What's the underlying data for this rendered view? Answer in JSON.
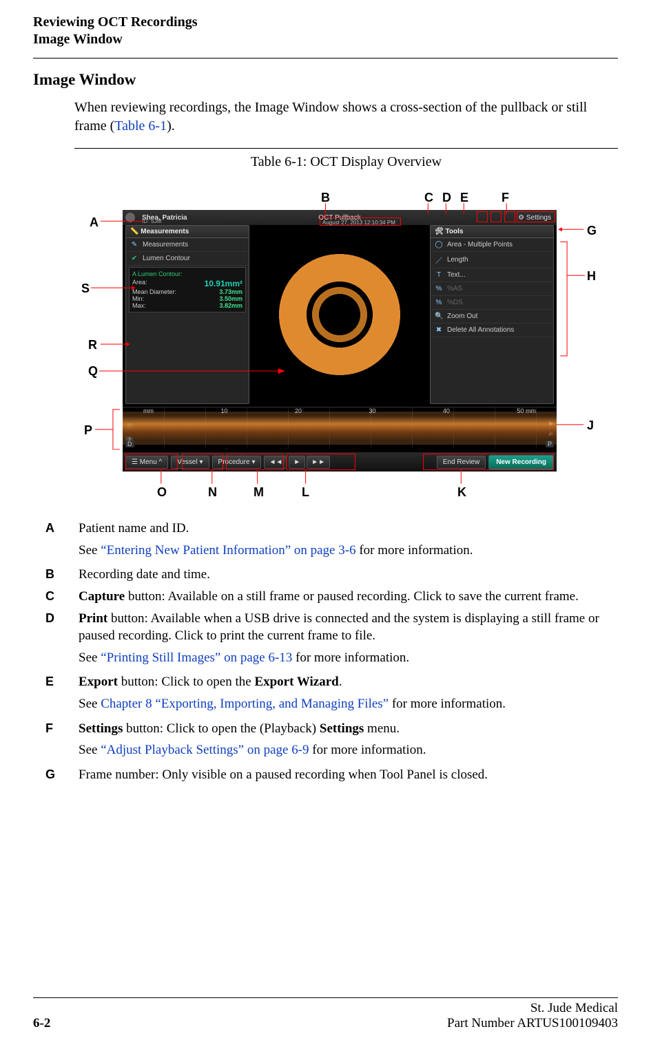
{
  "header": {
    "line1": "Reviewing OCT Recordings",
    "line2": "Image Window"
  },
  "section_title": "Image Window",
  "intro_pre": "When reviewing recordings, the Image Window shows a cross-section of the pullback or still frame (",
  "intro_xref": "Table 6-1",
  "intro_post": ").",
  "figure_caption": "Table 6-1:  OCT Display Overview",
  "shot": {
    "patient_name": "Shea, Patricia",
    "patient_id": "ID: SJM",
    "center_title": "OCT Pullback",
    "date": "August 27, 2013 12:10:34 PM",
    "settings": "Settings",
    "measurements_hdr": "Measurements",
    "meas_item1": "Measurements",
    "meas_item2": "Lumen Contour",
    "contour_title": "A Lumen Contour:",
    "area_label": "Area:",
    "area_val": "10.91mm²",
    "meandia_label": "Mean Diameter:",
    "meandia_val": "3.73mm",
    "min_label": "Min:",
    "min_val": "3.50mm",
    "max_label": "Max:",
    "max_val": "3.82mm",
    "tools_hdr": "Tools",
    "tool1": "Area - Multiple Points",
    "tool2": "Length",
    "tool3": "Text...",
    "tool4": "%AS",
    "tool5": "%DS",
    "tool6": "Zoom Out",
    "tool7": "Delete All Annotations",
    "ruler_unit": "mm",
    "ruler_10": "10",
    "ruler_20": "20",
    "ruler_30": "30",
    "ruler_40": "40",
    "ruler_50": "50",
    "ruler_50mm": "mm",
    "scale0": "0",
    "scale2": "2",
    "btn_menu": "Menu",
    "btn_vessel": "Vessel",
    "btn_procedure": "Procedure",
    "play_prev": "◄◄",
    "play_play": "►",
    "play_next": "►►",
    "btn_end": "End Review",
    "btn_new": "New Recording",
    "dp_label": "D",
    "pp_label": "P"
  },
  "labels": {
    "A": "A",
    "B": "B",
    "C": "C",
    "D": "D",
    "E": "E",
    "F": "F",
    "G": "G",
    "H": "H",
    "J": "J",
    "K": "K",
    "L": "L",
    "M": "M",
    "N": "N",
    "O": "O",
    "P": "P",
    "Q": "Q",
    "R": "R",
    "S": "S"
  },
  "desc": {
    "A": {
      "text": "Patient name and ID."
    },
    "A_see_pre": "See ",
    "A_see_link": "“Entering New Patient Information” on page 3-6",
    "A_see_post": " for more information.",
    "B": {
      "text": "Recording date and time."
    },
    "C_pre": "Capture",
    "C_post": " button: Available on a still frame or paused recording. Click to save the current frame.",
    "D_pre": "Print",
    "D_post": " button: Available when a USB drive is connected and the system is displaying a still frame or paused recording. Click to print the current frame to file.",
    "D_see_pre": "See ",
    "D_see_link": "“Printing Still Images” on page 6-13",
    "D_see_post": " for more information.",
    "E_pre": "Export",
    "E_mid": " button: Click to open the ",
    "E_bold2": "Export Wizard",
    "E_post": ".",
    "E_see_pre": "See ",
    "E_see_link": "Chapter 8 “Exporting, Importing, and Managing Files”",
    "E_see_post": " for more information.",
    "F_pre": "Settings",
    "F_mid": " button: Click to open the (Playback) ",
    "F_bold2": "Settings",
    "F_post": " menu.",
    "F_see_pre": "See ",
    "F_see_link": "“Adjust Playback Settings” on page 6-9",
    "F_see_post": " for more information.",
    "G": "Frame number: Only visible on a paused recording when Tool Panel is closed."
  },
  "footer": {
    "left": "6-2",
    "right1": "St. Jude Medical",
    "right2": "Part Number ARTUS100109403"
  }
}
